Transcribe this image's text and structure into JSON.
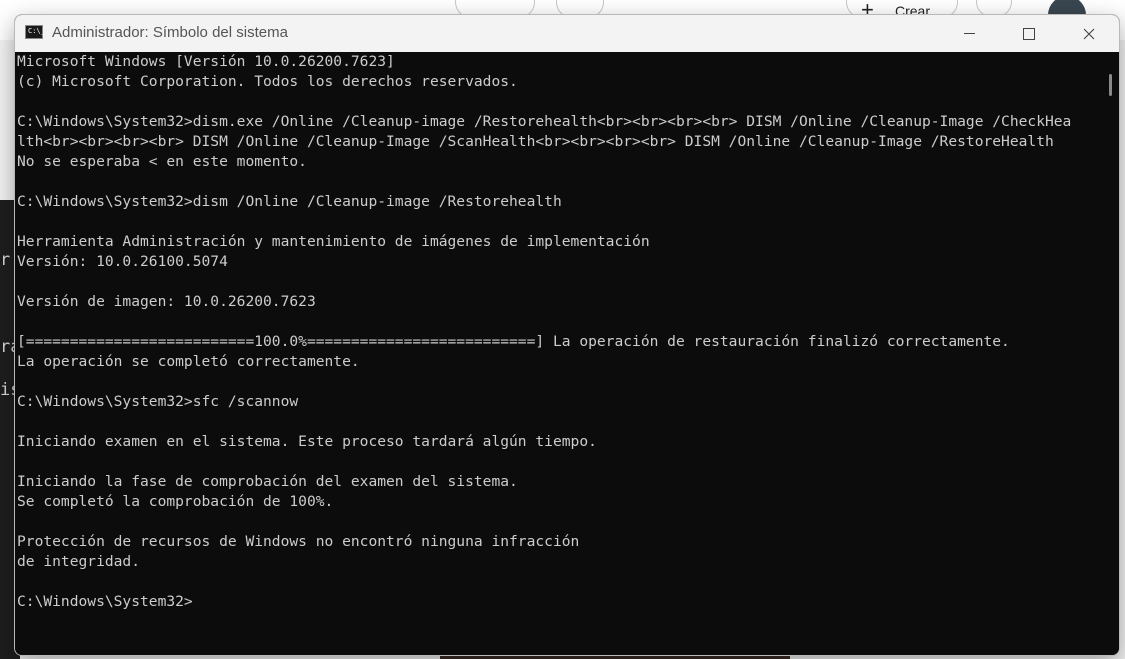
{
  "window": {
    "title": "Administrador: Símbolo del sistema",
    "icon_label": "C:\\_"
  },
  "console": {
    "lines": [
      "Microsoft Windows [Versión 10.0.26200.7623]",
      "(c) Microsoft Corporation. Todos los derechos reservados.",
      "",
      "C:\\Windows\\System32>dism.exe /Online /Cleanup-image /Restorehealth<br><br><br><br> DISM /Online /Cleanup-Image /CheckHea",
      "lth<br><br><br><br> DISM /Online /Cleanup-Image /ScanHealth<br><br><br><br> DISM /Online /Cleanup-Image /RestoreHealth",
      "No se esperaba < en este momento.",
      "",
      "C:\\Windows\\System32>dism /Online /Cleanup-image /Restorehealth",
      "",
      "Herramienta Administración y mantenimiento de imágenes de implementación",
      "Versión: 10.0.26100.5074",
      "",
      "Versión de imagen: 10.0.26200.7623",
      "",
      "[==========================100.0%==========================] La operación de restauración finalizó correctamente.",
      "La operación se completó correctamente.",
      "",
      "C:\\Windows\\System32>sfc /scannow",
      "",
      "Iniciando examen en el sistema. Este proceso tardará algún tiempo.",
      "",
      "Iniciando la fase de comprobación del examen del sistema.",
      "Se completó la comprobación de 100%.",
      "",
      "Protección de recursos de Windows no encontró ninguna infracción",
      "de integridad.",
      "",
      "C:\\Windows\\System32>"
    ]
  },
  "background": {
    "partial_button_label": "Crear",
    "left_fragments": [
      "r",
      "ra",
      "is"
    ]
  },
  "colors": {
    "console_bg": "#0c0c0c",
    "console_text": "#cccccc",
    "titlebar_bg": "#f3f3f3"
  }
}
